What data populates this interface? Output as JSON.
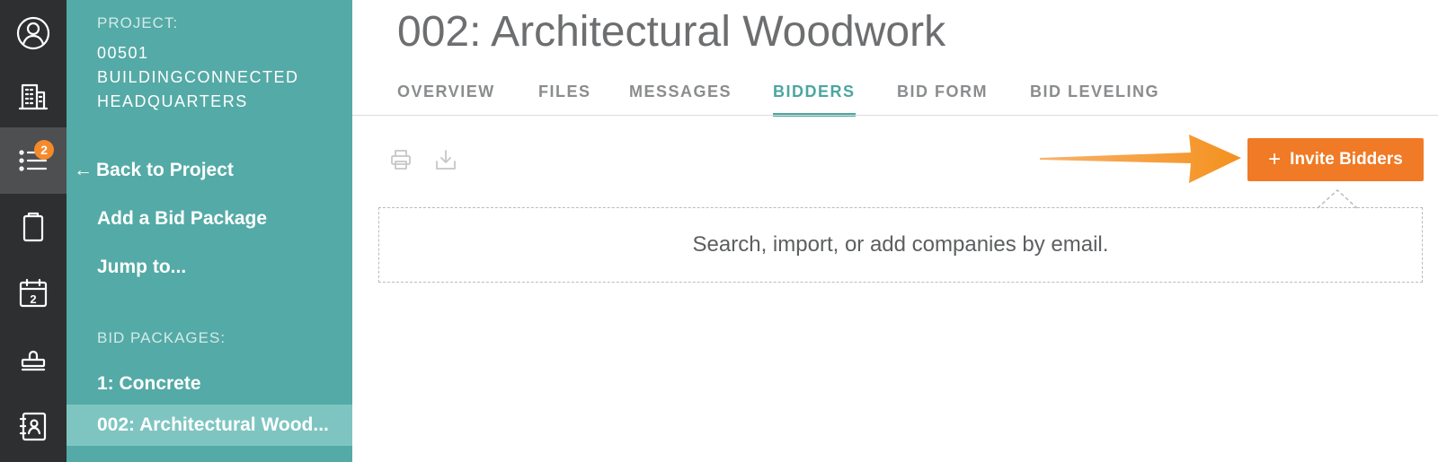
{
  "rail": {
    "items": [
      {
        "icon": "user-profile-icon"
      },
      {
        "icon": "building-icon"
      },
      {
        "icon": "list-icon",
        "badge": "2",
        "active": true
      },
      {
        "icon": "clipboard-icon"
      },
      {
        "icon": "calendar-icon",
        "glyph": "2"
      },
      {
        "icon": "stamp-icon"
      },
      {
        "icon": "address-book-icon"
      }
    ]
  },
  "sidebar": {
    "project_label": "PROJECT:",
    "project_name": "00501 BUILDINGCONNECTED HEADQUARTERS",
    "back_arrow": "←",
    "back_link": "Back to Project",
    "add_link": "Add a Bid Package",
    "jump_link": "Jump to...",
    "packages_label": "BID PACKAGES:",
    "packages": [
      {
        "label": "1: Concrete",
        "selected": false
      },
      {
        "label": "002: Architectural Wood...",
        "selected": true
      }
    ]
  },
  "page": {
    "title": "002: Architectural Woodwork",
    "tabs": [
      {
        "label": "OVERVIEW",
        "active": false
      },
      {
        "label": "FILES",
        "active": false
      },
      {
        "label": "MESSAGES",
        "active": false
      },
      {
        "label": "BIDDERS",
        "active": true
      },
      {
        "label": "BID FORM",
        "active": false
      },
      {
        "label": "BID LEVELING",
        "active": false
      }
    ],
    "toolbar": {
      "print_icon": "print-icon",
      "download_icon": "download-icon"
    },
    "invite_plus": "+",
    "invite_label": "Invite Bidders",
    "dropzone_text": "Search, import, or add companies by email."
  },
  "colors": {
    "rail_bg": "#2d2f30",
    "sidebar_bg": "#54aaa6",
    "accent": "#4ba6a1",
    "cta": "#f07a25",
    "badge": "#f58a2b"
  }
}
